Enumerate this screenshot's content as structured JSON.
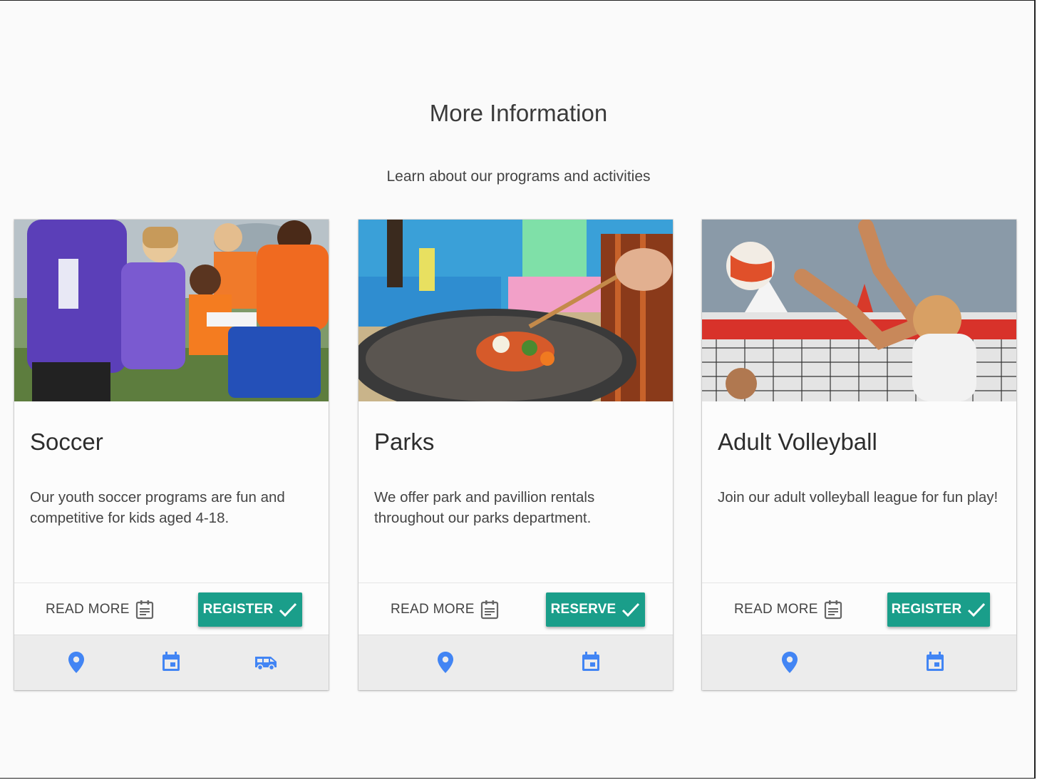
{
  "page": {
    "title": "More Information",
    "subtitle": "Learn about our programs and activities"
  },
  "colors": {
    "accent": "#1a9e8a",
    "icon_blue": "#4285f4",
    "background": "#fafafa"
  },
  "cards": [
    {
      "title": "Soccer",
      "text": "Our youth soccer programs are fun and competitive for kids aged 4-18.",
      "image_alt": "youth soccer players",
      "read_more_label": "READ MORE",
      "action_label": "REGISTER",
      "footer_icons": [
        "location-pin-icon",
        "calendar-icon",
        "shuttle-bus-icon"
      ]
    },
    {
      "title": "Parks",
      "text": "We offer park and pavillion rentals throughout our parks department.",
      "image_alt": "grilling kabobs in a park",
      "read_more_label": "READ MORE",
      "action_label": "RESERVE",
      "footer_icons": [
        "location-pin-icon",
        "calendar-icon"
      ]
    },
    {
      "title": "Adult Volleyball",
      "text": "Join our adult volleyball league for fun play!",
      "image_alt": "beach volleyball player spiking",
      "read_more_label": "READ MORE",
      "action_label": "REGISTER",
      "footer_icons": [
        "location-pin-icon",
        "calendar-icon"
      ]
    }
  ]
}
